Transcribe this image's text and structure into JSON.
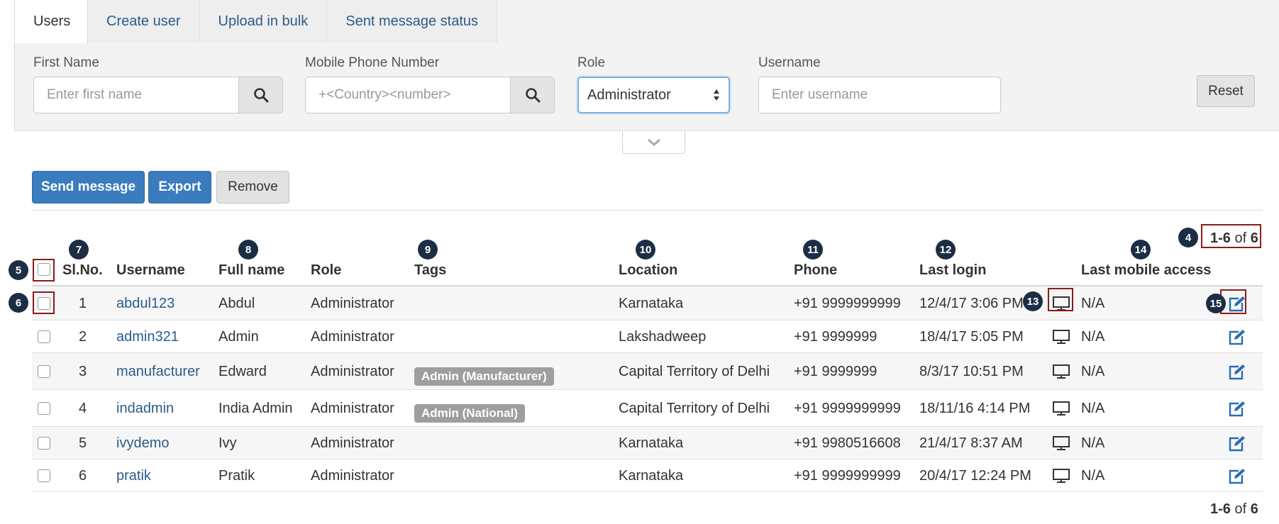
{
  "tabs": [
    {
      "label": "Users",
      "active": true
    },
    {
      "label": "Create user"
    },
    {
      "label": "Upload in bulk"
    },
    {
      "label": "Sent message status"
    }
  ],
  "filters": {
    "first_name": {
      "label": "First Name",
      "placeholder": "Enter first name"
    },
    "mobile": {
      "label": "Mobile Phone Number",
      "placeholder": "+<Country><number>"
    },
    "role": {
      "label": "Role",
      "value": "Administrator"
    },
    "username": {
      "label": "Username",
      "placeholder": "Enter username"
    },
    "reset_label": "Reset"
  },
  "actions": {
    "send_message": "Send message",
    "export": "Export",
    "remove": "Remove"
  },
  "pagination": {
    "range": "1-6",
    "of_word": "of",
    "total": "6"
  },
  "columns": {
    "sl_no": "Sl.No.",
    "username": "Username",
    "full_name": "Full name",
    "role": "Role",
    "tags": "Tags",
    "location": "Location",
    "phone": "Phone",
    "last_login": "Last login",
    "last_mobile_access": "Last mobile access"
  },
  "rows": [
    {
      "sl": "1",
      "username": "abdul123",
      "full_name": "Abdul",
      "role": "Administrator",
      "tag": "",
      "location": "Karnataka",
      "phone": "+91 9999999999",
      "last_login": "12/4/17 3:06 PM",
      "mobile_access": "N/A"
    },
    {
      "sl": "2",
      "username": "admin321",
      "full_name": "Admin",
      "role": "Administrator",
      "tag": "",
      "location": "Lakshadweep",
      "phone": "+91 9999999",
      "last_login": "18/4/17 5:05 PM",
      "mobile_access": "N/A"
    },
    {
      "sl": "3",
      "username": "manufacturer",
      "full_name": "Edward",
      "role": "Administrator",
      "tag": "Admin (Manufacturer)",
      "location": "Capital Territory of Delhi",
      "phone": "+91 9999999",
      "last_login": "8/3/17 10:51 PM",
      "mobile_access": "N/A"
    },
    {
      "sl": "4",
      "username": "indadmin",
      "full_name": "India Admin",
      "role": "Administrator",
      "tag": "Admin (National)",
      "location": "Capital Territory of Delhi",
      "phone": "+91 9999999999",
      "last_login": "18/11/16 4:14 PM",
      "mobile_access": "N/A"
    },
    {
      "sl": "5",
      "username": "ivydemo",
      "full_name": "Ivy",
      "role": "Administrator",
      "tag": "",
      "location": "Karnataka",
      "phone": "+91 9980516608",
      "last_login": "21/4/17 8:37 AM",
      "mobile_access": "N/A"
    },
    {
      "sl": "6",
      "username": "pratik",
      "full_name": "Pratik",
      "role": "Administrator",
      "tag": "",
      "location": "Karnataka",
      "phone": "+91 9999999999",
      "last_login": "20/4/17 12:24 PM",
      "mobile_access": "N/A"
    }
  ],
  "callouts": [
    "4",
    "5",
    "6",
    "7",
    "8",
    "9",
    "10",
    "11",
    "12",
    "13",
    "14",
    "15"
  ],
  "colors": {
    "primary": "#3a7cbe",
    "link": "#2a5c8a",
    "tag": "#9e9e9e",
    "callout": "#1c2e45",
    "highlight": "#8e1b1b"
  },
  "icons": [
    "search-icon",
    "sort-arrows-icon",
    "chevron-down-icon",
    "monitor-icon",
    "edit-icon"
  ]
}
